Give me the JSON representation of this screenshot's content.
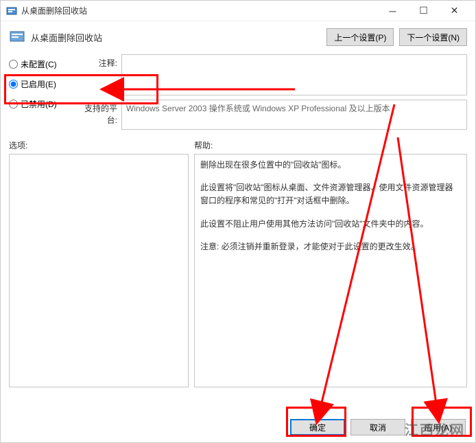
{
  "titlebar": {
    "title": "从桌面删除回收站"
  },
  "header": {
    "policy_name": "从桌面删除回收站",
    "prev_btn": "上一个设置(P)",
    "next_btn": "下一个设置(N)"
  },
  "radios": {
    "not_configured": "未配置(C)",
    "enabled": "已启用(E)",
    "disabled": "已禁用(D)"
  },
  "labels": {
    "comment": "注释:",
    "platform": "支持的平台:",
    "options": "选项:",
    "help": "帮助:"
  },
  "platform_text": "Windows Server 2003 操作系统或 Windows XP Professional 及以上版本",
  "help_paragraphs": [
    "删除出现在很多位置中的\"回收站\"图标。",
    "此设置将\"回收站\"图标从桌面、文件资源管理器、使用文件资源管理器窗口的程序和常见的\"打开\"对话框中删除。",
    "此设置不阻止用户使用其他方法访问\"回收站\"文件夹中的内容。",
    "注意: 必须注销并重新登录，才能使对于此设置的更改生效。"
  ],
  "footer": {
    "ok": "确定",
    "cancel": "取消",
    "apply": "应用(A)"
  },
  "watermark": "江西龙网"
}
